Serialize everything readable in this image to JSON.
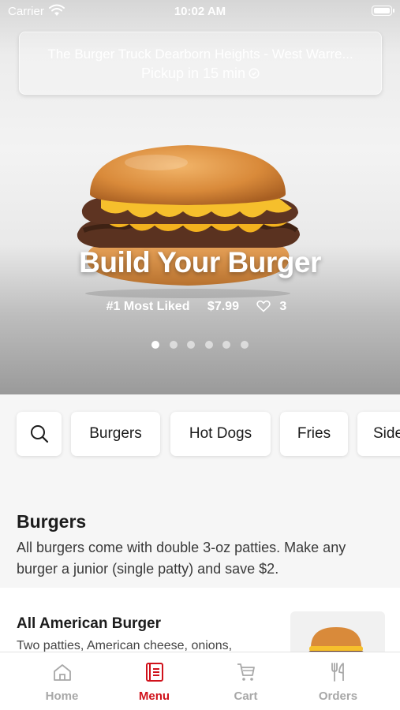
{
  "status_bar": {
    "carrier": "Carrier",
    "time": "10:02 AM"
  },
  "location": {
    "name": "The Burger Truck Dearborn Heights - West Warre...",
    "pickup": "Pickup in 15 min"
  },
  "hero": {
    "title": "Build Your Burger",
    "rank": "#1 Most Liked",
    "price": "$7.99",
    "likes": "3",
    "slide_count": 6,
    "active_slide": 1
  },
  "categories": [
    "Burgers",
    "Hot Dogs",
    "Fries",
    "Sides"
  ],
  "section": {
    "title": "Burgers",
    "description": "All burgers come with double 3-oz patties. Make any burger a junior (single patty) and save $2."
  },
  "menu_items": [
    {
      "name": "All American Burger",
      "description": "Two patties, American cheese, onions,"
    }
  ],
  "tabs": [
    {
      "label": "Home",
      "icon": "home-icon",
      "active": false
    },
    {
      "label": "Menu",
      "icon": "menu-icon",
      "active": true
    },
    {
      "label": "Cart",
      "icon": "cart-icon",
      "active": false
    },
    {
      "label": "Orders",
      "icon": "orders-icon",
      "active": false
    }
  ],
  "colors": {
    "accent": "#d0121b",
    "inactive_tab": "#a8a8a8"
  }
}
